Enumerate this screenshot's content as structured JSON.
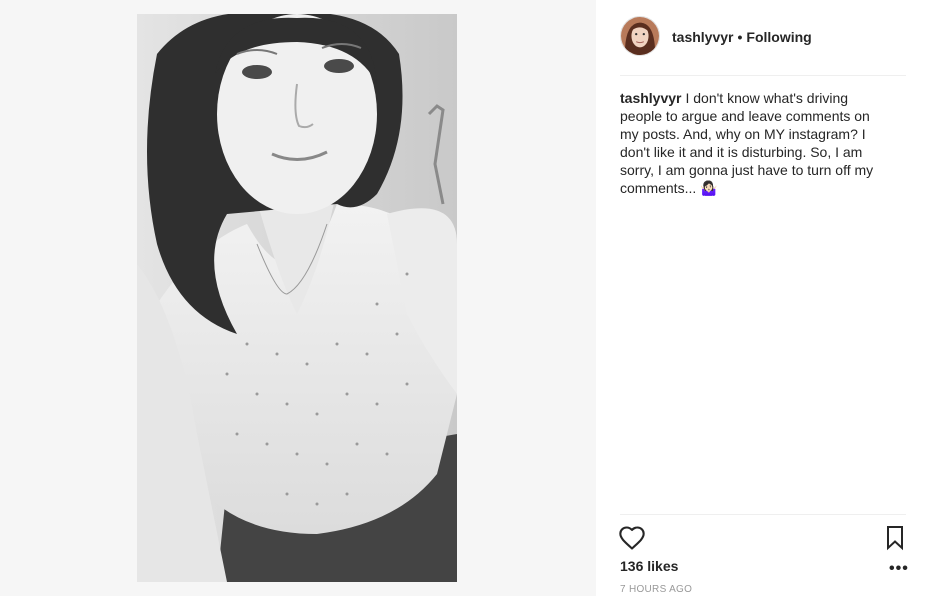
{
  "post": {
    "username": "tashlyvyr",
    "separator": "•",
    "follow_status": "Following",
    "caption_user": "tashlyvyr",
    "caption_text": "I don't know what's driving people to argue and leave comments on my posts. And, why on MY instagram? I don't like it and it is disturbing. So, I am sorry, I am gonna just have to turn off my comments... 🤷🏻‍♀️",
    "likes": "136 likes",
    "timestamp": "7 HOURS AGO",
    "more_label": "•••"
  },
  "icons": {
    "like": "heart-outline-icon",
    "save": "bookmark-outline-icon",
    "more": "more-options-icon"
  },
  "colors": {
    "text": "#262626",
    "muted": "#999999",
    "divider": "#efefef",
    "media_background": "#f6f6f6"
  }
}
